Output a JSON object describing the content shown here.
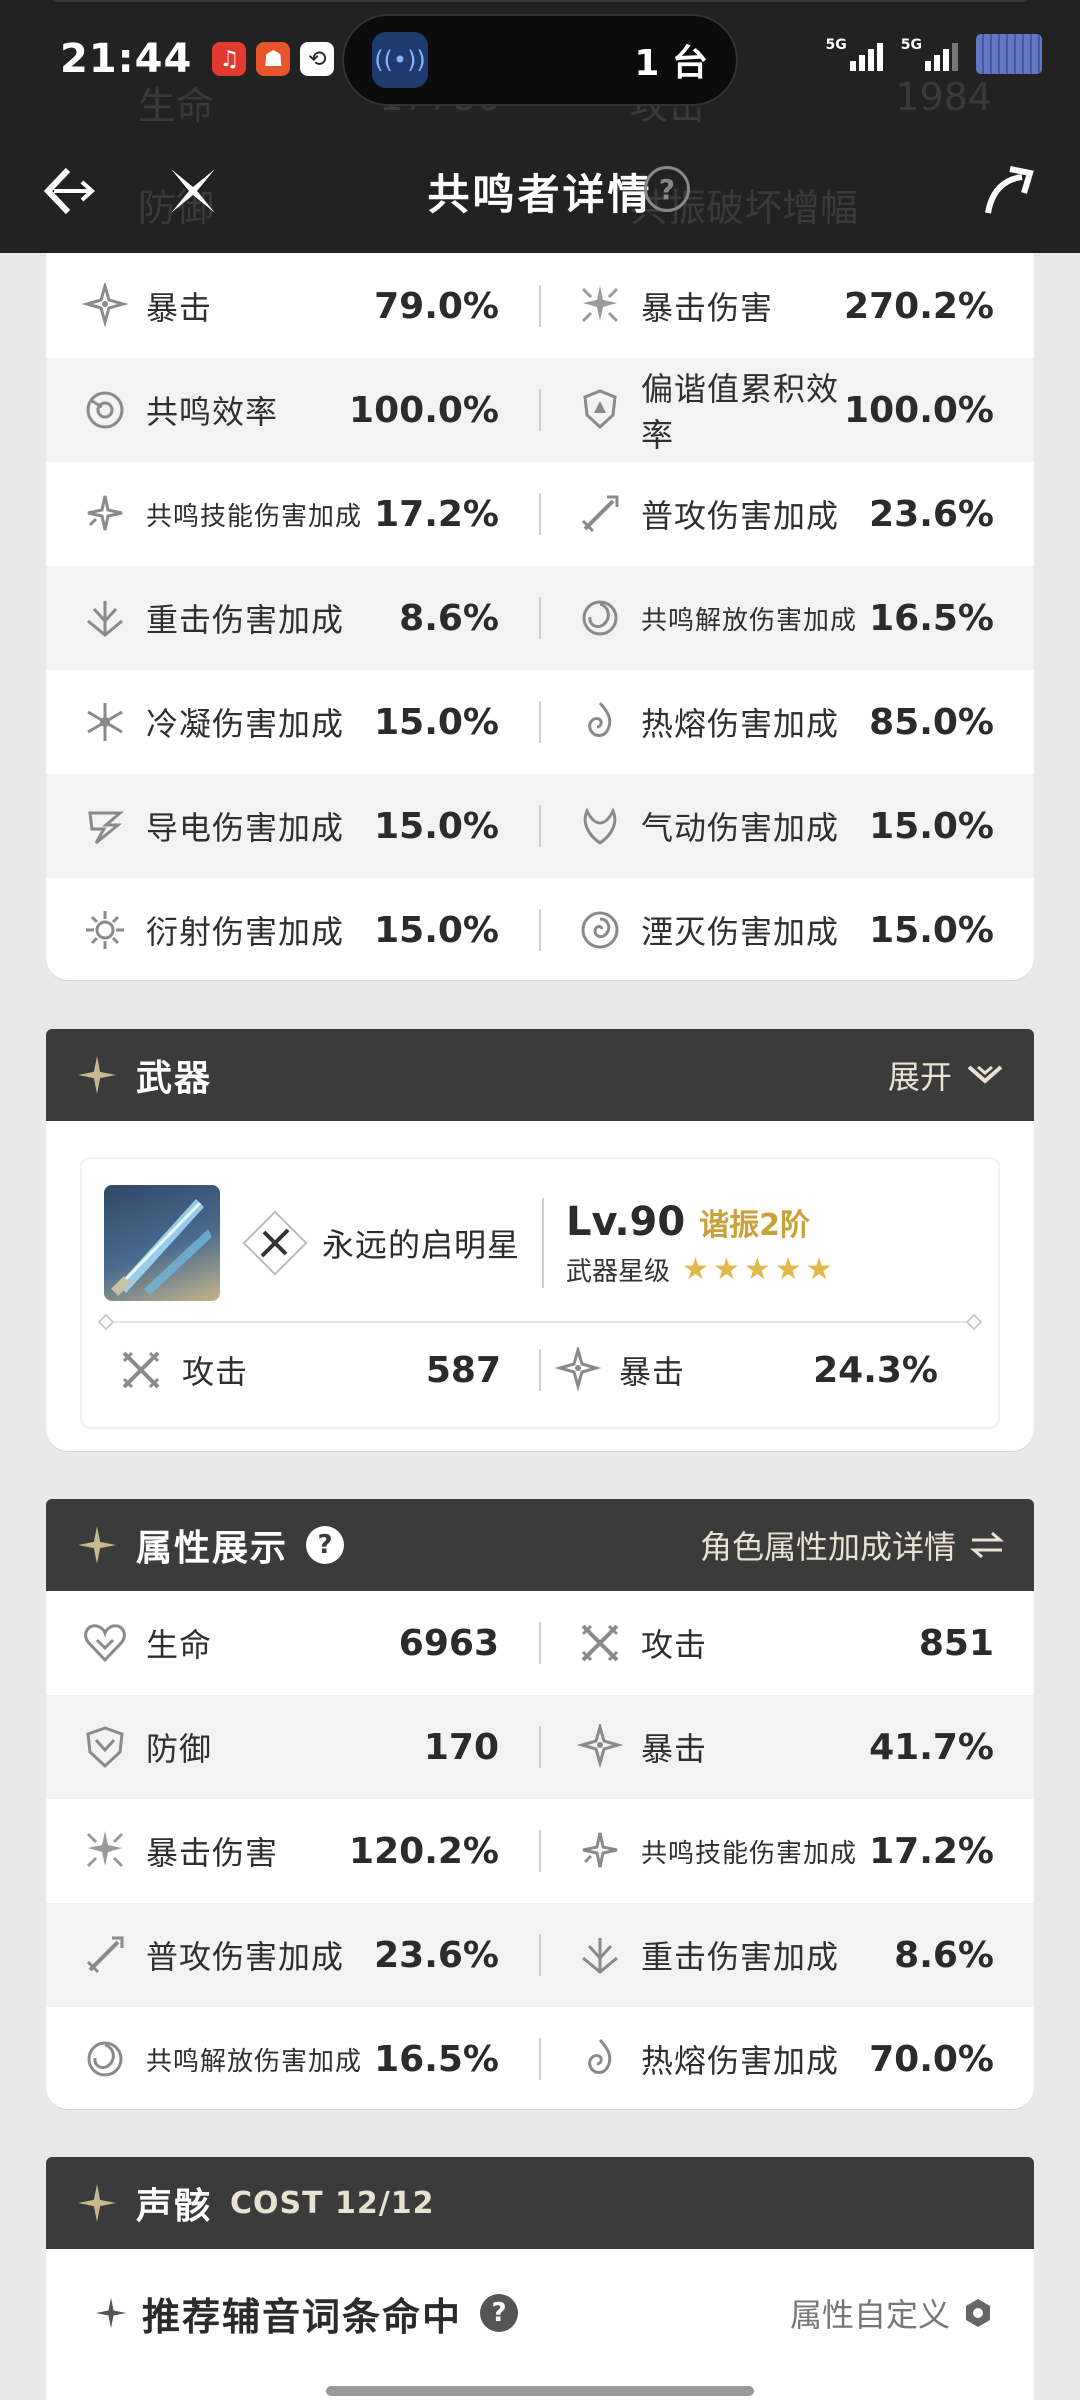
{
  "status_bar": {
    "time": "21:44",
    "pill_text": "1 台",
    "signal_1_label": "5G",
    "signal_2_label": "5G"
  },
  "nav": {
    "title": "共鸣者详情",
    "help": "?"
  },
  "background_header": {
    "row1_left_name": "生命",
    "row1_left_value": "17786",
    "row1_right_name": "攻击",
    "row1_right_value": "1984",
    "row2_left_name": "防御",
    "row2_right_name": "共振破坏增幅"
  },
  "stats_card": {
    "rows": [
      [
        {
          "name": "暴击",
          "value": "79.0%",
          "icon": "crit-icon"
        },
        {
          "name": "暴击伤害",
          "value": "270.2%",
          "icon": "crit-damage-icon"
        }
      ],
      [
        {
          "name": "共鸣效率",
          "value": "100.0%",
          "icon": "energy-regen-icon"
        },
        {
          "name": "偏谐值累积效率",
          "value": "100.0%",
          "icon": "shield-icon"
        }
      ],
      [
        {
          "name": "共鸣技能伤害加成",
          "value": "17.2%",
          "icon": "skill-icon"
        },
        {
          "name": "普攻伤害加成",
          "value": "23.6%",
          "icon": "basic-attack-icon"
        }
      ],
      [
        {
          "name": "重击伤害加成",
          "value": "8.6%",
          "icon": "heavy-attack-icon"
        },
        {
          "name": "共鸣解放伤害加成",
          "value": "16.5%",
          "icon": "liberation-icon"
        }
      ],
      [
        {
          "name": "冷凝伤害加成",
          "value": "15.0%",
          "icon": "glacio-icon"
        },
        {
          "name": "热熔伤害加成",
          "value": "85.0%",
          "icon": "fusion-icon"
        }
      ],
      [
        {
          "name": "导电伤害加成",
          "value": "15.0%",
          "icon": "electro-icon"
        },
        {
          "name": "气动伤害加成",
          "value": "15.0%",
          "icon": "aero-icon"
        }
      ],
      [
        {
          "name": "衍射伤害加成",
          "value": "15.0%",
          "icon": "spectro-icon"
        },
        {
          "name": "湮灭伤害加成",
          "value": "15.0%",
          "icon": "havoc-icon"
        }
      ]
    ]
  },
  "weapon_card": {
    "title": "武器",
    "expand_label": "展开",
    "name": "永远的启明星",
    "level": "Lv.90",
    "rank": "谐振2阶",
    "star_label": "武器星级",
    "stars": 5,
    "stats": [
      {
        "name": "攻击",
        "value": "587",
        "icon": "attack-icon"
      },
      {
        "name": "暴击",
        "value": "24.3%",
        "icon": "crit-icon"
      }
    ]
  },
  "attr_card": {
    "title": "属性展示",
    "help": "?",
    "detail_link": "角色属性加成详情",
    "rows": [
      [
        {
          "name": "生命",
          "value": "6963",
          "icon": "hp-icon"
        },
        {
          "name": "攻击",
          "value": "851",
          "icon": "attack-icon"
        }
      ],
      [
        {
          "name": "防御",
          "value": "170",
          "icon": "defense-icon"
        },
        {
          "name": "暴击",
          "value": "41.7%",
          "icon": "crit-icon"
        }
      ],
      [
        {
          "name": "暴击伤害",
          "value": "120.2%",
          "icon": "crit-damage-icon"
        },
        {
          "name": "共鸣技能伤害加成",
          "value": "17.2%",
          "icon": "skill-icon"
        }
      ],
      [
        {
          "name": "普攻伤害加成",
          "value": "23.6%",
          "icon": "basic-attack-icon"
        },
        {
          "name": "重击伤害加成",
          "value": "8.6%",
          "icon": "heavy-attack-icon"
        }
      ],
      [
        {
          "name": "共鸣解放伤害加成",
          "value": "16.5%",
          "icon": "liberation-icon"
        },
        {
          "name": "热熔伤害加成",
          "value": "70.0%",
          "icon": "fusion-icon"
        }
      ]
    ]
  },
  "echo_card": {
    "title": "声骸",
    "cost": "COST 12/12",
    "sub_title": "推荐辅音词条命中",
    "help": "?",
    "custom_label": "属性自定义"
  },
  "colors": {
    "header_bg": "#222222",
    "card_head_bg": "#3b3b3b",
    "rank_gold": "#c9a23a",
    "star_gold": "#e0b94a"
  }
}
